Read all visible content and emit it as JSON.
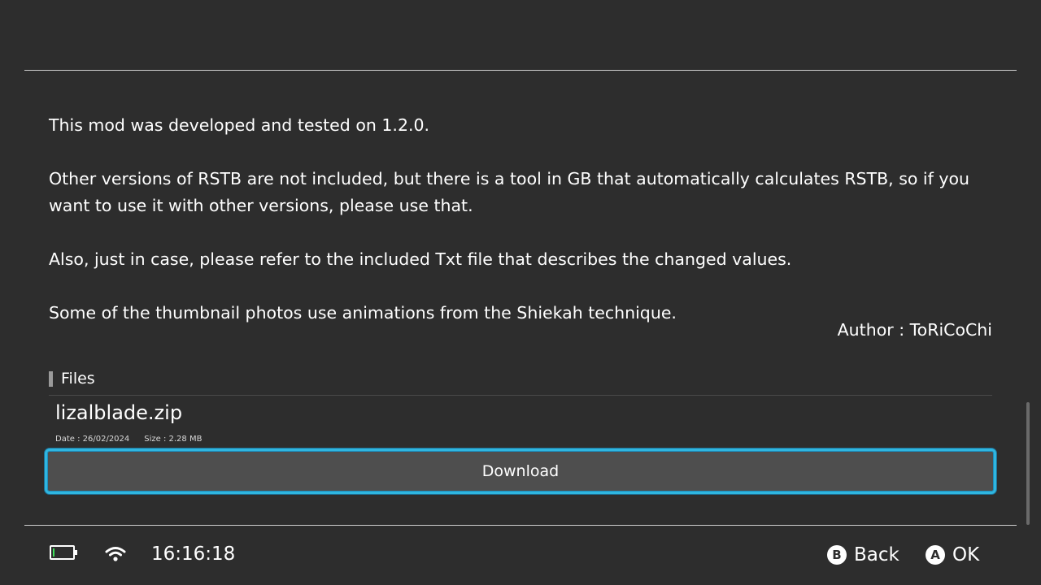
{
  "description": {
    "paragraphs": [
      "This mod was developed and tested on 1.2.0.",
      "Other versions of RSTB are not included, but there is a tool in GB that automatically calculates RSTB, so if you want to use it with other versions, please use that.",
      "Also, just in case, please refer to the included Txt file that describes the changed values.",
      "Some of the thumbnail photos use animations from the Shiekah technique."
    ]
  },
  "author": "Author : ToRiCoChi",
  "files": {
    "header": "Files",
    "items": [
      {
        "name": "lizalblade.zip",
        "date": "Date : 26/02/2024",
        "size": "Size : 2.28 MB",
        "download_label": "Download"
      }
    ]
  },
  "status_bar": {
    "battery_level": 0.1,
    "battery_color": "#3fe05a",
    "wifi_icon": "wifi-icon",
    "time": "16:16:18"
  },
  "controls": {
    "back": {
      "glyph": "B",
      "label": "Back"
    },
    "ok": {
      "glyph": "A",
      "label": "OK"
    }
  },
  "accent_color": "#2fb6e0"
}
